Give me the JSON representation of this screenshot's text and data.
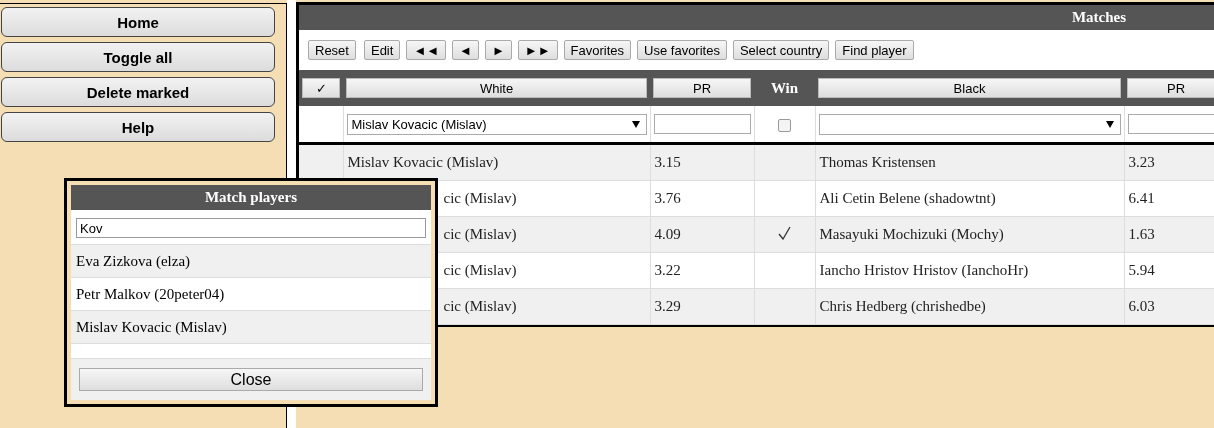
{
  "sidebar": {
    "buttons": [
      "Home",
      "Toggle all",
      "Delete marked",
      "Help"
    ]
  },
  "matches": {
    "title": "Matches",
    "toolbar": [
      "Reset",
      "Edit",
      "◄◄",
      "◄",
      "►",
      "►►",
      "Favorites",
      "Use favorites",
      "Select country",
      "Find player"
    ],
    "columns": [
      {
        "kind": "button",
        "label": "✓"
      },
      {
        "kind": "button",
        "label": "White"
      },
      {
        "kind": "button",
        "label": "PR"
      },
      {
        "kind": "text",
        "label": "Win"
      },
      {
        "kind": "button",
        "label": "Black"
      },
      {
        "kind": "button",
        "label": "PR"
      }
    ],
    "filters": {
      "white": "Mislav Kovacic (Mislav)",
      "win_checked": false
    },
    "rows": [
      {
        "white": "Mislav Kovacic (Mislav)",
        "covered": false,
        "white_pr": "3.15",
        "win": false,
        "black": "Thomas Kristensen",
        "black_pr": "3.23"
      },
      {
        "white": "cic (Mislav)",
        "covered": true,
        "white_pr": "3.76",
        "win": false,
        "black": "Ali Cetin Belene (shadowtnt)",
        "black_pr": "6.41"
      },
      {
        "white": "cic (Mislav)",
        "covered": true,
        "white_pr": "4.09",
        "win": true,
        "black": "Masayuki Mochizuki (Mochy)",
        "black_pr": "1.63"
      },
      {
        "white": "cic (Mislav)",
        "covered": true,
        "white_pr": "3.22",
        "win": false,
        "black": "Iancho Hristov Hristov (IanchoHr)",
        "black_pr": "5.94"
      },
      {
        "white": "cic (Mislav)",
        "covered": true,
        "white_pr": "3.29",
        "win": false,
        "black": "Chris Hedberg (chrishedbe)",
        "black_pr": "6.03"
      }
    ]
  },
  "popup": {
    "title": "Match players",
    "search": "Kov",
    "results": [
      "Eva Zizkova (elza)",
      "Petr Malkov (20peter04)",
      "Mislav Kovacic (Mislav)"
    ],
    "close": "Close"
  }
}
